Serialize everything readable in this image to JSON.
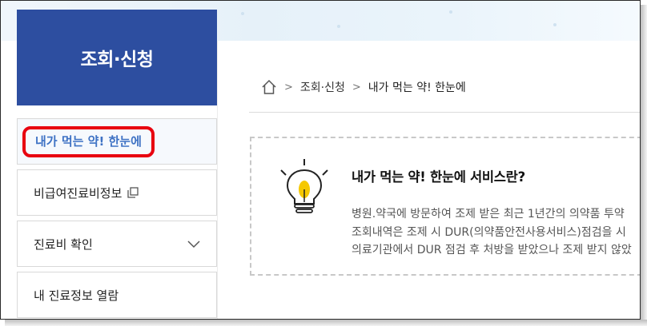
{
  "sidebar": {
    "title": "조회·신청",
    "items": [
      {
        "label": "내가 먹는 약! 한눈에"
      },
      {
        "label": "비급여진료비정보"
      },
      {
        "label": "진료비 확인"
      },
      {
        "label": "내 진료정보 열람"
      }
    ]
  },
  "breadcrumb": {
    "level1": "조회·신청",
    "current": "내가 먹는 약! 한눈에"
  },
  "info": {
    "title": "내가 먹는 약! 한눈에 서비스란?",
    "lines": [
      "병원.약국에 방문하여 조제 받은 최근 1년간의 의약품 투약",
      "조회내역은 조제 시 DUR(의약품안전사용서비스)점검을 시",
      "의료기관에서 DUR 점검 후 처방을 받았으나 조제 받지 않았"
    ]
  },
  "colors": {
    "brand_blue": "#2d4ea0",
    "active_text": "#3e72c4",
    "highlight_red": "#e8000f"
  }
}
